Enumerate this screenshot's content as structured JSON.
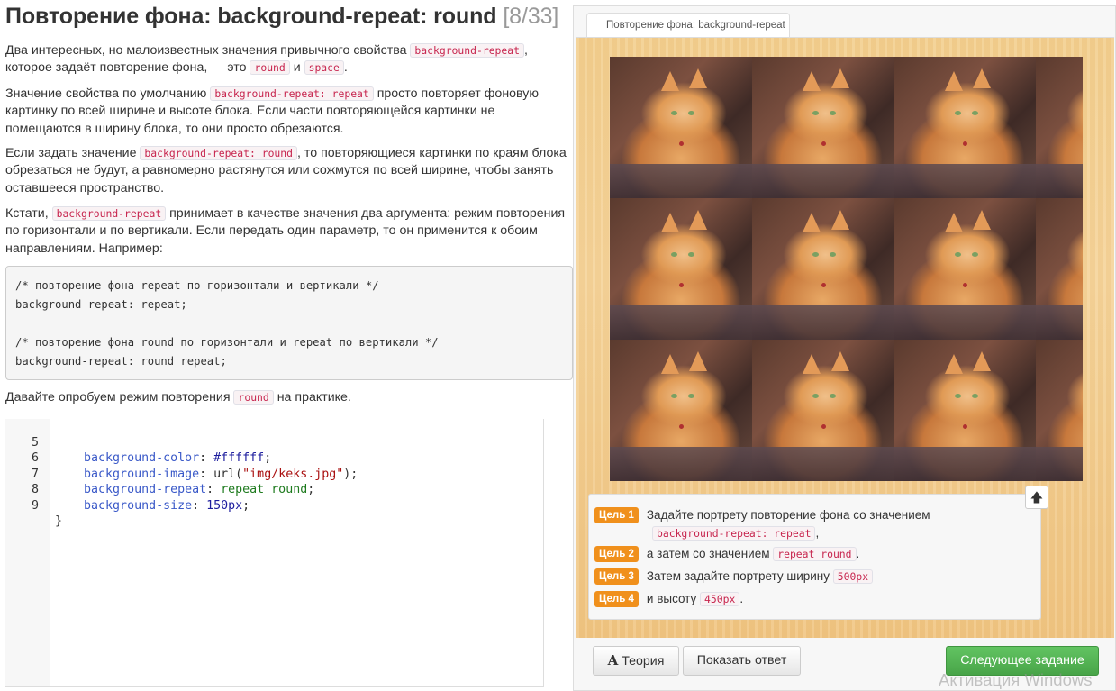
{
  "title": {
    "main": "Повторение фона: background-repeat: round",
    "counter": "[8/33]"
  },
  "p1": {
    "before": "Два интересных, но малоизвестных значения привычного свойства ",
    "code1": "background-repeat",
    "mid": ", которое задаёт повторение фона, — это ",
    "code2": "round",
    "and": " и ",
    "code3": "space",
    "end": "."
  },
  "p2": {
    "before": "Значение свойства по умолчанию ",
    "code": "background-repeat: repeat",
    "after": " просто повторяет фоновую картинку по всей ширине и высоте блока. Если части повторяющейся картинки не помещаются в ширину блока, то они просто обрезаются."
  },
  "p3": {
    "before": "Если задать значение ",
    "code": "background-repeat: round",
    "after": ", то повторяющиеся картинки по краям блока обрезаться не будут, а равномерно растянутся или сожмутся по всей ширине, чтобы занять оставшееся пространство."
  },
  "p4": {
    "before": "Кстати, ",
    "code": "background-repeat",
    "after": " принимает в качестве значения два аргумента: режим повторения по горизонтали и по вертикали. Если передать один параметр, то он применится к обоим направлениям. Например:"
  },
  "codebox": {
    "l1": "/* повторение фона repeat по горизонтали и вертикали */",
    "l2": "background-repeat: repeat;",
    "l3": "",
    "l4": "/* повторение фона round по горизонтали и repeat по вертикали */",
    "l5": "background-repeat: round repeat;"
  },
  "p5": {
    "before": "Давайте опробуем режим повторения ",
    "code": "round",
    "after": " на практике."
  },
  "editor": {
    "lines": [
      {
        "num": "5",
        "prop": "background-color",
        "sep": ": ",
        "val": "#ffffff",
        "end": ";"
      },
      {
        "num": "6",
        "prop": "background-image",
        "sep": ": url(",
        "val": "\"img/keks.jpg\"",
        "end": ");"
      },
      {
        "num": "7",
        "prop": "background-repeat",
        "sep": ": ",
        "val": "repeat round",
        "end": ";"
      },
      {
        "num": "8",
        "prop": "background-size",
        "sep": ": ",
        "val": "150px",
        "end": ";"
      },
      {
        "num": "9",
        "text": "}"
      }
    ]
  },
  "right": {
    "tab_label": "Повторение фона: background-repeat",
    "goals": {
      "g1": {
        "badge": "Цель 1",
        "text": "Задайте портрету повторение фона со значением",
        "code": "background-repeat: repeat",
        "after": ","
      },
      "g2": {
        "badge": "Цель 2",
        "text": "а затем со значением ",
        "code": "repeat round",
        "after": "."
      },
      "g3": {
        "badge": "Цель 3",
        "text": "Затем задайте портрету ширину ",
        "code": "500px",
        "after": ""
      },
      "g4": {
        "badge": "Цель 4",
        "text": "и высоту ",
        "code": "450px",
        "after": "."
      }
    },
    "buttons": {
      "theory_icon": "A",
      "theory": "Теория",
      "answer": "Показать ответ",
      "next": "Следующее задание",
      "up_icon": "arrow-up-icon"
    }
  },
  "watermark": "Активация Windows",
  "colors": {
    "goal_badge": "#f0901c",
    "next_button": "#5cb85c",
    "inline_code": "#c7254e"
  }
}
